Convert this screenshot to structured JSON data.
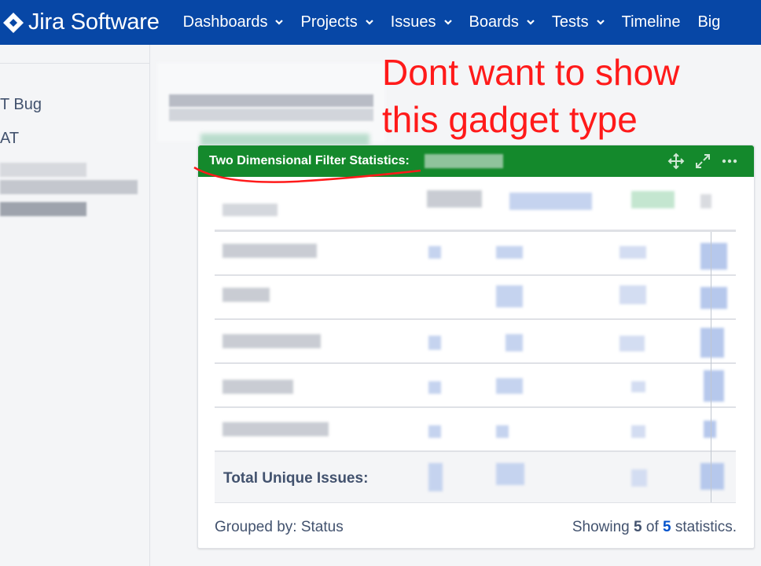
{
  "app": {
    "product_name": "Jira Software"
  },
  "nav": [
    {
      "label": "Dashboards",
      "dropdown": true
    },
    {
      "label": "Projects",
      "dropdown": true
    },
    {
      "label": "Issues",
      "dropdown": true
    },
    {
      "label": "Boards",
      "dropdown": true
    },
    {
      "label": "Tests",
      "dropdown": true
    },
    {
      "label": "Timeline",
      "dropdown": false
    },
    {
      "label": "Big",
      "dropdown": false
    }
  ],
  "sidebar": {
    "items": [
      {
        "label": "T Bug"
      },
      {
        "label": "AT"
      }
    ]
  },
  "annotation": {
    "line1": "Dont want to show",
    "line2": "this gadget type",
    "color": "#ff1a1a"
  },
  "gadget": {
    "title": "Two Dimensional Filter Statistics:",
    "header_color": "#14892c",
    "icons": [
      "move-icon",
      "expand-icon",
      "more-icon"
    ],
    "total_label": "Total Unique Issues:",
    "footer": {
      "grouped_by": "Grouped by: Status",
      "showing_prefix": "Showing",
      "showing_count": "5",
      "showing_of": "of",
      "showing_total": "5",
      "showing_suffix": "statistics."
    }
  },
  "colors": {
    "nav_bg": "#0747a6",
    "page_bg": "#f4f5f7",
    "link": "#0052cc"
  }
}
